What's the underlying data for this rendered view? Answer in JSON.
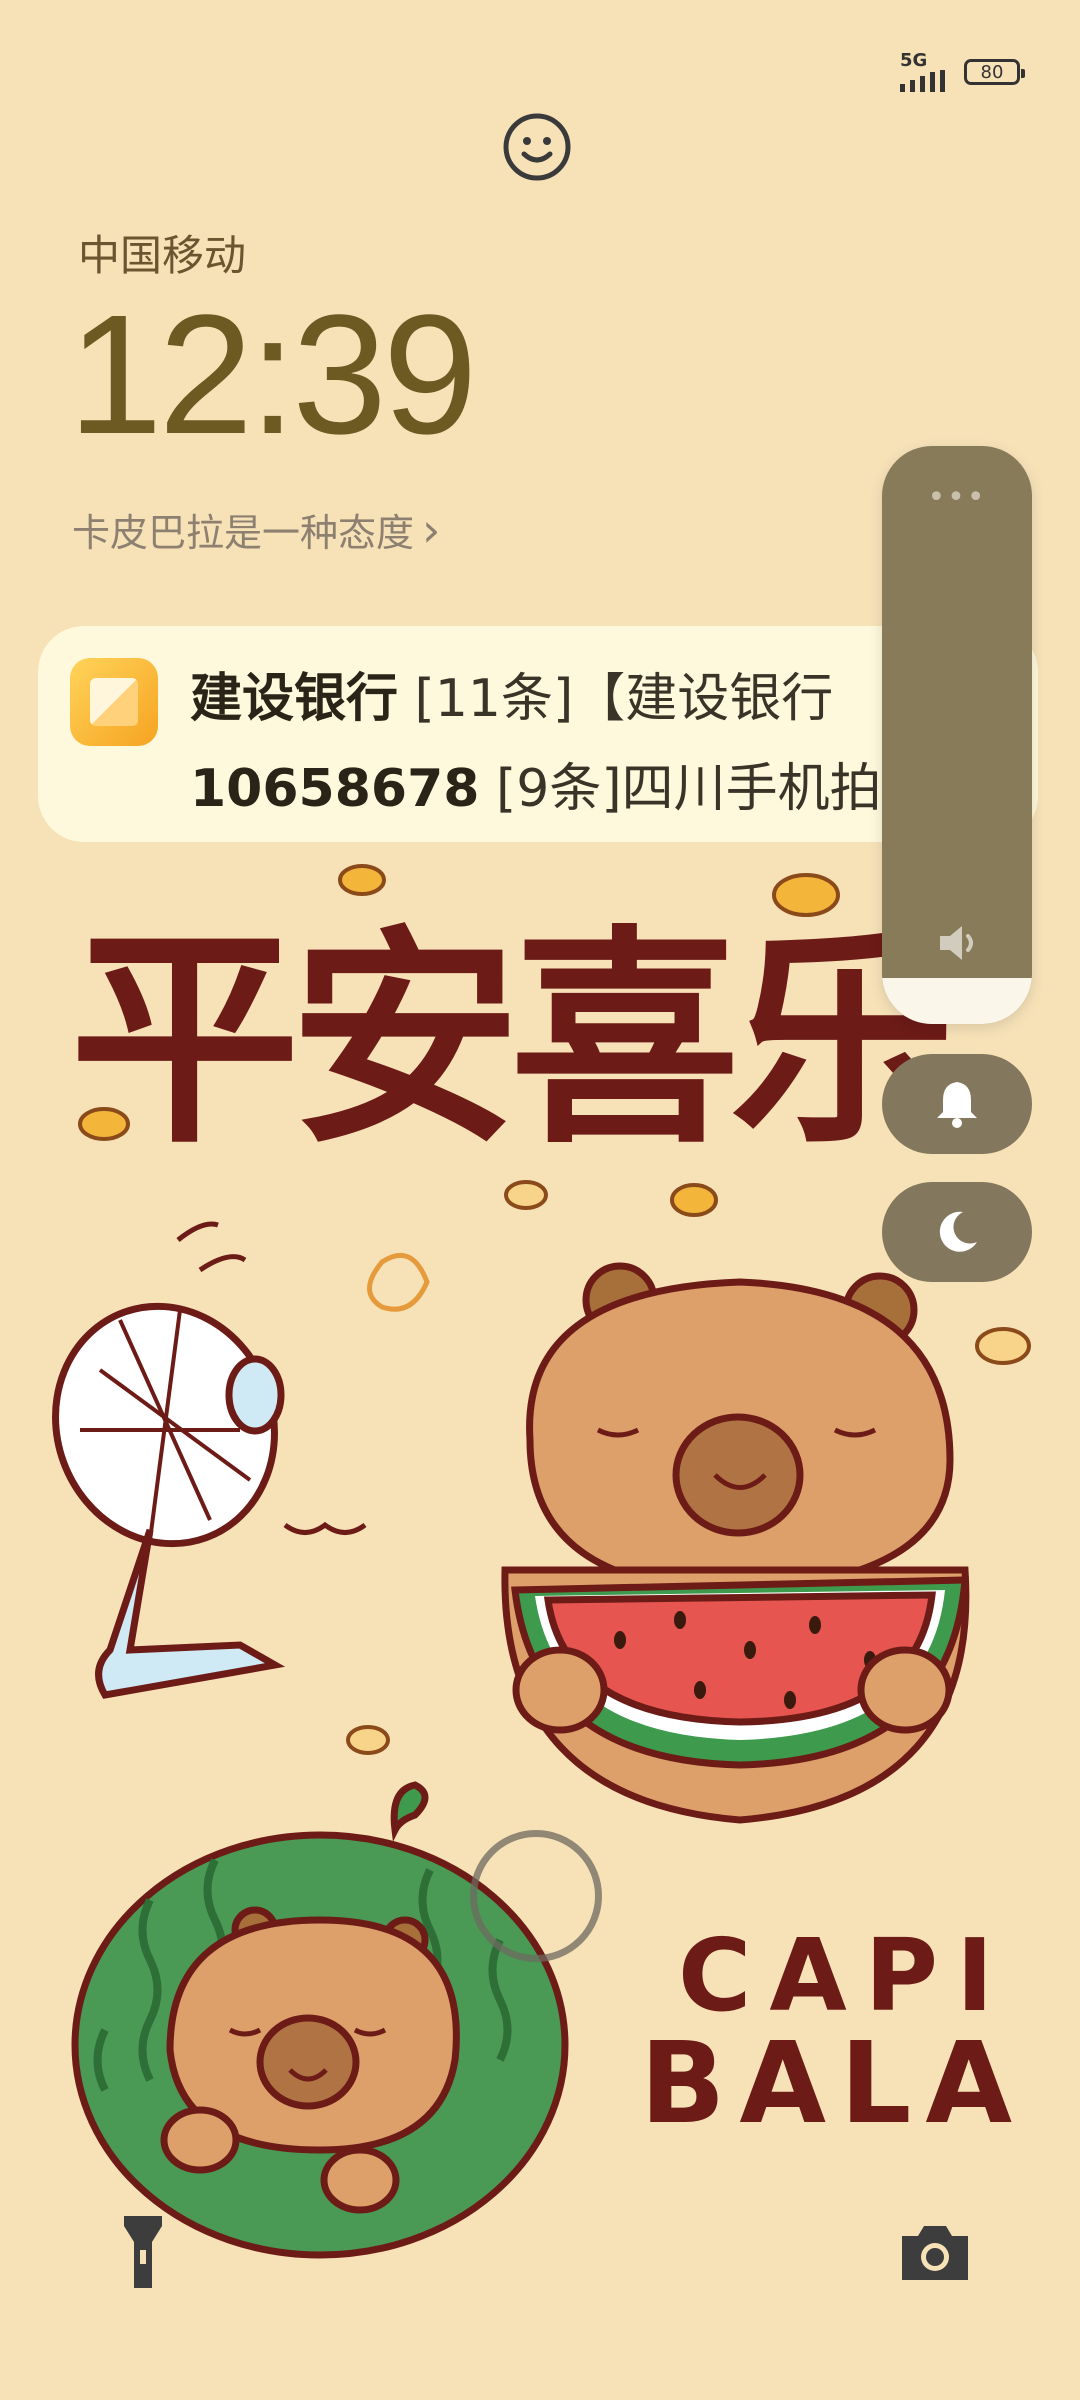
{
  "status_bar": {
    "network": "5G",
    "battery": "80"
  },
  "lockscreen": {
    "carrier": "中国移动",
    "time": "12:39",
    "tagline": "卡皮巴拉是一种态度",
    "tagline_arrow": "›"
  },
  "notification": {
    "line1_sender": "建设银行",
    "line1_rest": " [11条]【建设银行",
    "line2_sender": "10658678",
    "line2_rest": " [9条]四川手机拍"
  },
  "volume_panel": {
    "menu_glyph": "•••",
    "level": 0.08
  },
  "wallpaper": {
    "headline": "平安喜乐",
    "brand_line1": "CAPI",
    "brand_line2": "BALA"
  },
  "colors": {
    "background": "#f7e2b8",
    "text_dark": "#6c5a22",
    "panel": "#887b5a",
    "wallpaper_red": "#6d1b17"
  },
  "icons": {
    "face": "smiley-face-icon",
    "flash": "flashlight-icon",
    "camera": "camera-icon",
    "bell": "bell-icon",
    "moon": "moon-icon",
    "speaker": "speaker-icon"
  }
}
